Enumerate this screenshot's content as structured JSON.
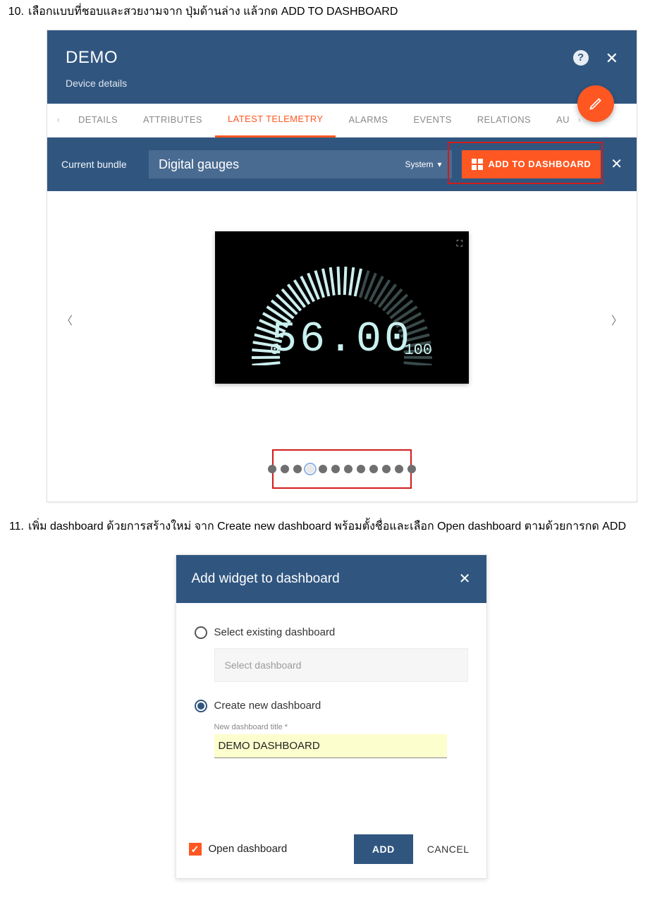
{
  "steps": {
    "s10": {
      "num": "10.",
      "text": "เลือกแบบที่ชอบและสวยงามจาก ปุ่มด้านล่าง แล้วกด ADD TO DASHBOARD"
    },
    "s11": {
      "num": "11.",
      "text": "เพิ่ม dashboard ด้วยการสร้างใหม่ จาก Create new dashboard พร้อมตั้งชื่อและเลือก Open dashboard ตามด้วยการกด ADD"
    }
  },
  "panel": {
    "title": "DEMO",
    "subtitle": "Device details",
    "tabs": [
      "DETAILS",
      "ATTRIBUTES",
      "LATEST TELEMETRY",
      "ALARMS",
      "EVENTS",
      "RELATIONS",
      "AU"
    ],
    "activeTab": "LATEST TELEMETRY",
    "bundleLabel": "Current bundle",
    "bundleValue": "Digital gauges",
    "bundleScope": "System",
    "addToDash": "ADD TO DASHBOARD",
    "gauge": {
      "value": "56.00",
      "min": "0",
      "max": "100"
    },
    "dots": {
      "total": 12,
      "active": 3
    }
  },
  "dialog": {
    "title": "Add widget to dashboard",
    "optExisting": "Select existing dashboard",
    "selectPlaceholder": "Select dashboard",
    "optCreate": "Create new dashboard",
    "newTitleLabel": "New dashboard title *",
    "newTitleValue": "DEMO DASHBOARD",
    "openDash": "Open dashboard",
    "add": "ADD",
    "cancel": "CANCEL"
  }
}
